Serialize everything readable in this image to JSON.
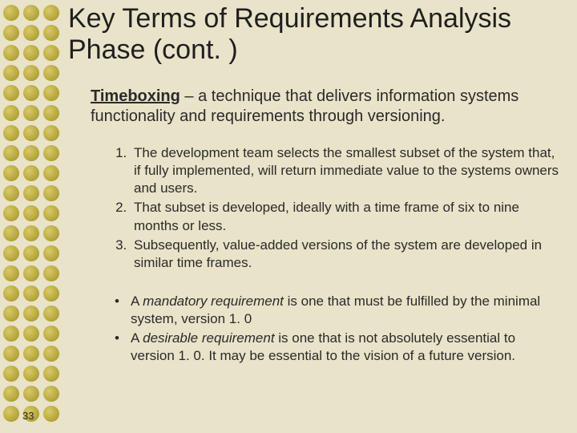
{
  "title": "Key Terms of Requirements Analysis Phase (cont. )",
  "intro": {
    "term": "Timeboxing",
    "rest": " – a technique that delivers information systems functionality and requirements through versioning."
  },
  "steps": [
    "The development team selects the smallest subset of the system that, if fully implemented, will return immediate value to the systems owners and users.",
    "That subset is developed, ideally with a time frame of six to nine months or less.",
    "Subsequently, value-added versions of the system are developed in similar time frames."
  ],
  "defs": [
    {
      "em": "mandatory requirement",
      "prefix": "A ",
      "rest": " is one that must be fulfilled by the minimal system, version 1. 0"
    },
    {
      "em": "desirable requirement",
      "prefix": "A ",
      "rest": " is one that is not absolutely essential to version 1. 0. It may be essential to the vision of a future version."
    }
  ],
  "pageNumber": "33"
}
